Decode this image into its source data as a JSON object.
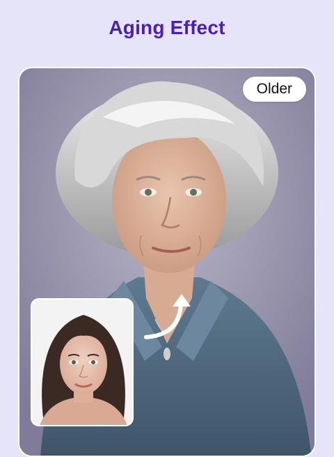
{
  "header": {
    "title": "Aging Effect"
  },
  "preview": {
    "result_label": "Older",
    "result_image_icon": "elderly-woman-portrait-icon",
    "original_image_icon": "young-woman-portrait-icon",
    "transform_icon": "curved-arrow-icon"
  },
  "colors": {
    "accent": "#4a1fb8",
    "background": "#e6e4f8",
    "badge_bg": "#ffffff"
  }
}
